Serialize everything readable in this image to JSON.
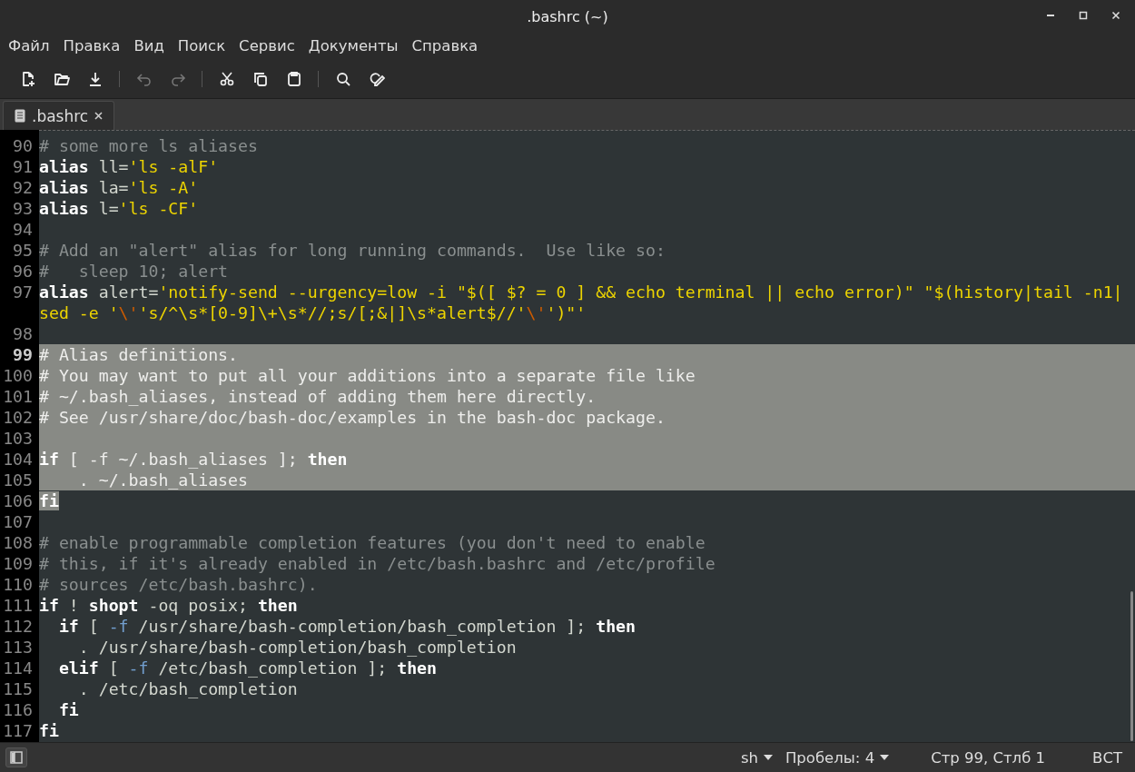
{
  "window": {
    "title": ".bashrc (~)"
  },
  "menu": [
    "Файл",
    "Правка",
    "Вид",
    "Поиск",
    "Сервис",
    "Документы",
    "Справка"
  ],
  "toolbar": [
    [
      {
        "kind": "new",
        "disabled": false
      },
      {
        "kind": "open",
        "disabled": false
      },
      {
        "kind": "save",
        "disabled": false
      }
    ],
    [
      {
        "kind": "undo",
        "disabled": true
      },
      {
        "kind": "redo",
        "disabled": true
      }
    ],
    [
      {
        "kind": "cut",
        "disabled": false
      },
      {
        "kind": "copy",
        "disabled": false
      },
      {
        "kind": "paste",
        "disabled": false
      }
    ],
    [
      {
        "kind": "search",
        "disabled": false
      },
      {
        "kind": "replace",
        "disabled": false
      }
    ]
  ],
  "tabs": [
    {
      "label": ".bashrc",
      "selected": true
    }
  ],
  "editor": {
    "lines": [
      {
        "n": "90",
        "current": false,
        "selected": false,
        "segments": [
          {
            "text": "# some more ls aliases",
            "kind": "comment"
          }
        ]
      },
      {
        "n": "91",
        "current": false,
        "selected": false,
        "segments": [
          {
            "text": "alias",
            "kind": "keyword"
          },
          {
            "text": " ll=",
            "kind": "plain"
          },
          {
            "text": "'ls -alF'",
            "kind": "string"
          }
        ]
      },
      {
        "n": "92",
        "current": false,
        "selected": false,
        "segments": [
          {
            "text": "alias",
            "kind": "keyword"
          },
          {
            "text": " la=",
            "kind": "plain"
          },
          {
            "text": "'ls -A'",
            "kind": "string"
          }
        ]
      },
      {
        "n": "93",
        "current": false,
        "selected": false,
        "segments": [
          {
            "text": "alias",
            "kind": "keyword"
          },
          {
            "text": " l=",
            "kind": "plain"
          },
          {
            "text": "'ls -CF'",
            "kind": "string"
          }
        ]
      },
      {
        "n": "94",
        "current": false,
        "selected": false
      },
      {
        "n": "95",
        "current": false,
        "selected": false,
        "segments": [
          {
            "text": "# Add an \"alert\" alias for long running commands.  Use like so:",
            "kind": "comment"
          }
        ]
      },
      {
        "n": "96",
        "current": false,
        "selected": false,
        "segments": [
          {
            "text": "#   sleep 10; alert",
            "kind": "comment"
          }
        ]
      },
      {
        "n": "97",
        "current": false,
        "selected": false,
        "segments": [
          {
            "text": "alias",
            "kind": "keyword"
          },
          {
            "text": " alert=",
            "kind": "plain"
          },
          {
            "text": "'notify-send --urgency=low -i \"$([ $? = 0 ] && echo terminal || echo error)\" \"$(history|tail -n1|",
            "kind": "string"
          }
        ],
        "wrapped": [
          {
            "text": "sed -e '",
            "kind": "string"
          },
          {
            "text": "\\'",
            "kind": "escape"
          },
          {
            "text": "'s/^\\s*[0-9]\\+\\s*//;s/[;&|]\\s*alert$//'",
            "kind": "string"
          },
          {
            "text": "\\'",
            "kind": "escape"
          },
          {
            "text": "')\"'",
            "kind": "string"
          }
        ]
      },
      {
        "n": "98",
        "current": false,
        "selected": false
      },
      {
        "n": "99",
        "current": true,
        "selected": true,
        "segments": [
          {
            "text": "# Alias definitions.",
            "kind": "comment"
          }
        ]
      },
      {
        "n": "100",
        "current": false,
        "selected": true,
        "segments": [
          {
            "text": "# You may want to put all your additions into a separate file like",
            "kind": "comment"
          }
        ]
      },
      {
        "n": "101",
        "current": false,
        "selected": true,
        "segments": [
          {
            "text": "# ~/.bash_aliases, instead of adding them here directly.",
            "kind": "comment"
          }
        ]
      },
      {
        "n": "102",
        "current": false,
        "selected": true,
        "segments": [
          {
            "text": "# See /usr/share/doc/bash-doc/examples in the bash-doc package.",
            "kind": "comment"
          }
        ]
      },
      {
        "n": "103",
        "current": false,
        "selected": true
      },
      {
        "n": "104",
        "current": false,
        "selected": true,
        "segments": [
          {
            "text": "if",
            "kind": "keyword"
          },
          {
            "text": " [ -f ~/.bash_aliases ]; ",
            "kind": "plain"
          },
          {
            "text": "then",
            "kind": "keyword"
          }
        ]
      },
      {
        "n": "105",
        "current": false,
        "selected": true,
        "segments": [
          {
            "text": "    . ~/.bash_aliases",
            "kind": "plain"
          }
        ]
      },
      {
        "n": "106",
        "current": false,
        "selected": false,
        "segments": [
          {
            "text": "fi",
            "kind": "keyword",
            "selected": true
          }
        ]
      },
      {
        "n": "107",
        "current": false,
        "selected": false
      },
      {
        "n": "108",
        "current": false,
        "selected": false,
        "segments": [
          {
            "text": "# enable programmable completion features (you don't need to enable",
            "kind": "comment"
          }
        ]
      },
      {
        "n": "109",
        "current": false,
        "selected": false,
        "segments": [
          {
            "text": "# this, if it's already enabled in /etc/bash.bashrc and /etc/profile",
            "kind": "comment"
          }
        ]
      },
      {
        "n": "110",
        "current": false,
        "selected": false,
        "segments": [
          {
            "text": "# sources /etc/bash.bashrc).",
            "kind": "comment"
          }
        ]
      },
      {
        "n": "111",
        "current": false,
        "selected": false,
        "segments": [
          {
            "text": "if",
            "kind": "keyword"
          },
          {
            "text": " ! ",
            "kind": "plain"
          },
          {
            "text": "shopt",
            "kind": "keyword"
          },
          {
            "text": " -oq posix; ",
            "kind": "plain"
          },
          {
            "text": "then",
            "kind": "keyword"
          }
        ]
      },
      {
        "n": "112",
        "current": false,
        "selected": false,
        "segments": [
          {
            "text": "  if",
            "kind": "keyword"
          },
          {
            "text": " [ ",
            "kind": "plain"
          },
          {
            "text": "-f",
            "kind": "option"
          },
          {
            "text": " /usr/share/bash-completion/bash_completion ]; ",
            "kind": "plain"
          },
          {
            "text": "then",
            "kind": "keyword"
          }
        ]
      },
      {
        "n": "113",
        "current": false,
        "selected": false,
        "segments": [
          {
            "text": "    . /usr/share/bash-completion/bash_completion",
            "kind": "plain"
          }
        ]
      },
      {
        "n": "114",
        "current": false,
        "selected": false,
        "segments": [
          {
            "text": "  elif",
            "kind": "keyword"
          },
          {
            "text": " [ ",
            "kind": "plain"
          },
          {
            "text": "-f",
            "kind": "option"
          },
          {
            "text": " /etc/bash_completion ]; ",
            "kind": "plain"
          },
          {
            "text": "then",
            "kind": "keyword"
          }
        ]
      },
      {
        "n": "115",
        "current": false,
        "selected": false,
        "segments": [
          {
            "text": "    . /etc/bash_completion",
            "kind": "plain"
          }
        ]
      },
      {
        "n": "116",
        "current": false,
        "selected": false,
        "segments": [
          {
            "text": "  fi",
            "kind": "keyword"
          }
        ]
      },
      {
        "n": "117",
        "current": false,
        "selected": false,
        "segments": [
          {
            "text": "fi",
            "kind": "keyword"
          }
        ]
      }
    ]
  },
  "status_bar": {
    "language": "sh",
    "indent": "Пробелы: 4",
    "position": "Стр 99, Стлб 1",
    "mode": "ВСТ"
  }
}
